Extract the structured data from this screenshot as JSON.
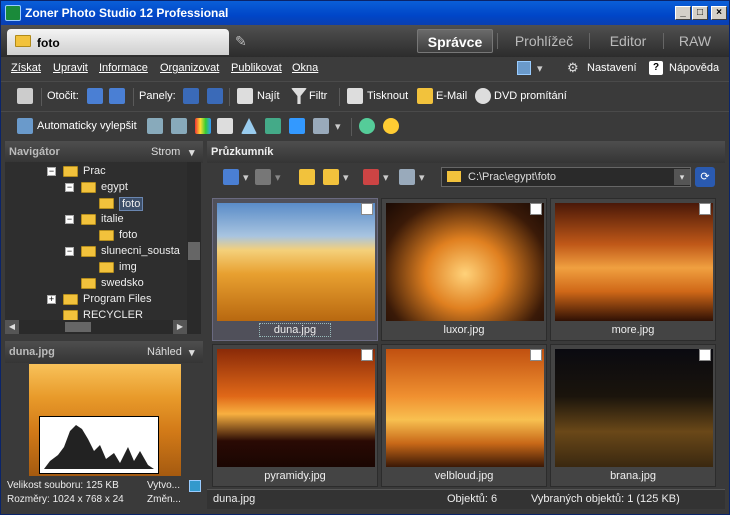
{
  "window": {
    "title": "Zoner Photo Studio 12 Professional"
  },
  "file_tab": {
    "label": "foto"
  },
  "mode_tabs": [
    {
      "label": "Správce",
      "active": true
    },
    {
      "label": "Prohlížeč",
      "active": false
    },
    {
      "label": "Editor",
      "active": false
    },
    {
      "label": "RAW",
      "active": false
    }
  ],
  "menu": [
    "Získat",
    "Upravit",
    "Informace",
    "Organizovat",
    "Publikovat",
    "Okna"
  ],
  "menu_right": {
    "settings": "Nastavení",
    "help": "Nápověda"
  },
  "toolbar1": {
    "rotate": "Otočit:",
    "panels": "Panely:",
    "find": "Najít",
    "filter": "Filtr",
    "print": "Tisknout",
    "email": "E-Mail",
    "dvd": "DVD promítání"
  },
  "toolbar2": {
    "auto_enhance": "Automaticky vylepšit"
  },
  "navigator": {
    "title": "Navigátor",
    "mode": "Strom",
    "tree": [
      {
        "label": "Prac",
        "level": 0,
        "expanded": true
      },
      {
        "label": "egypt",
        "level": 1,
        "expanded": true
      },
      {
        "label": "foto",
        "level": 2,
        "selected": true
      },
      {
        "label": "italie",
        "level": 1,
        "expanded": true
      },
      {
        "label": "foto",
        "level": 2
      },
      {
        "label": "slunecni_sousta",
        "level": 1,
        "expanded": true
      },
      {
        "label": "img",
        "level": 2
      },
      {
        "label": "swedsko",
        "level": 1
      },
      {
        "label": "Program Files",
        "level": 0,
        "expanded": false
      },
      {
        "label": "RECYCLER",
        "level": 0
      }
    ]
  },
  "preview": {
    "title": "duna.jpg",
    "mode": "Náhled",
    "info": [
      {
        "label": "Velikost souboru:",
        "value": "125 KB"
      },
      {
        "label": "Rozměry:",
        "value": "1024 x 768 x 24"
      }
    ],
    "info_right": [
      "Vytvo...",
      "Změn..."
    ]
  },
  "explorer": {
    "title": "Průzkumník",
    "path": "C:\\Prac\\egypt\\foto",
    "files": [
      {
        "name": "duna.jpg",
        "selected": true
      },
      {
        "name": "luxor.jpg",
        "selected": false
      },
      {
        "name": "more.jpg",
        "selected": false
      },
      {
        "name": "pyramidy.jpg",
        "selected": false
      },
      {
        "name": "velbloud.jpg",
        "selected": false
      },
      {
        "name": "brana.jpg",
        "selected": false
      }
    ]
  },
  "status": {
    "file": "duna.jpg",
    "count": "Objektů: 6",
    "selected": "Vybraných objektů: 1 (125 KB)"
  }
}
